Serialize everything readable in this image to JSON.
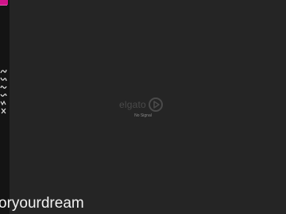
{
  "overlay": {
    "accent_color": "#d0148a",
    "icons": [
      "wave-icon",
      "wave-icon",
      "wave-icon",
      "wave-icon",
      "wave-icon",
      "close-icon"
    ]
  },
  "logo": {
    "text": "elgato",
    "icon": "elgato-logo-icon"
  },
  "status": {
    "text": "No Signal"
  },
  "caption": {
    "text": "oryourdream"
  }
}
